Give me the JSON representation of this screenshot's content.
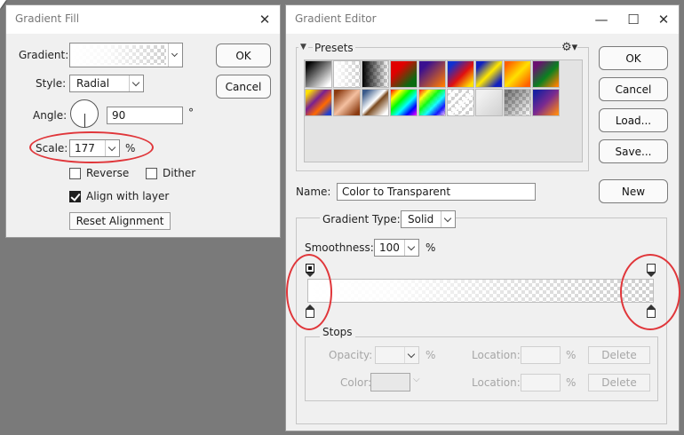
{
  "gradient_fill": {
    "title": "Gradient Fill",
    "gradient_label": "Gradient:",
    "style_label": "Style:",
    "style_value": "Radial",
    "angle_label": "Angle:",
    "angle_value": "90",
    "angle_unit": "°",
    "scale_label": "Scale:",
    "scale_value": "177",
    "scale_unit": "%",
    "reverse_label": "Reverse",
    "reverse_checked": false,
    "dither_label": "Dither",
    "dither_checked": false,
    "align_label": "Align with layer",
    "align_checked": true,
    "reset_label": "Reset Alignment",
    "ok_label": "OK",
    "cancel_label": "Cancel"
  },
  "gradient_editor": {
    "title": "Gradient Editor",
    "presets_label": "Presets",
    "buttons": {
      "ok": "OK",
      "cancel": "Cancel",
      "load": "Load...",
      "save": "Save...",
      "new": "New"
    },
    "name_label": "Name:",
    "name_value": "Color to Transparent",
    "gradient_type_label": "Gradient Type:",
    "gradient_type_value": "Solid",
    "smoothness_label": "Smoothness:",
    "smoothness_value": "100",
    "smoothness_unit": "%",
    "stops": {
      "label": "Stops",
      "opacity_label": "Opacity:",
      "opacity_unit": "%",
      "location_label": "Location:",
      "location_unit": "%",
      "delete_label": "Delete",
      "color_label": "Color:"
    },
    "presets": [
      "black-white",
      "white-transparent",
      "black-transparent",
      "red-green",
      "violet-orange",
      "blue-red-yellow",
      "blue-yellow-blue",
      "orange-yellow-orange",
      "violet-green-orange",
      "yellow-violet-orange-blue",
      "copper",
      "chrome",
      "spectrum",
      "transparent-rainbow",
      "transparent-stripes",
      "neutral-density",
      "transparent-checker",
      "blue-violet-orange"
    ]
  },
  "colors": {
    "annotation": "#e0363a",
    "background": "#7a7a7a",
    "dialog": "#f0f0f0"
  }
}
